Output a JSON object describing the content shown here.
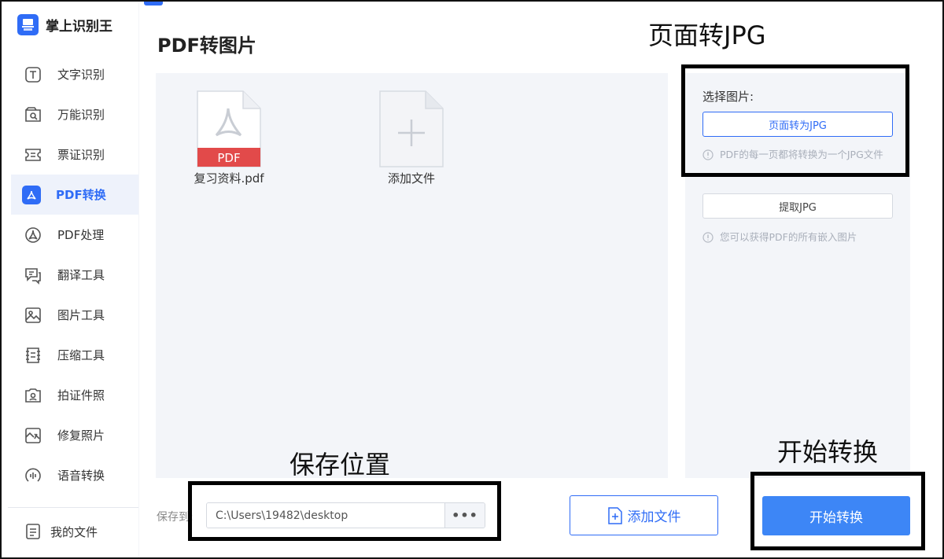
{
  "app": {
    "name": "掌上识别王",
    "brand_color": "#2f6cf6"
  },
  "sidebar": {
    "items": [
      {
        "label": "文字识别",
        "icon": "text-recognition-icon"
      },
      {
        "label": "万能识别",
        "icon": "universal-recognition-icon"
      },
      {
        "label": "票证识别",
        "icon": "ticket-recognition-icon"
      },
      {
        "label": "PDF转换",
        "icon": "pdf-convert-icon",
        "active": true
      },
      {
        "label": "PDF处理",
        "icon": "pdf-process-icon"
      },
      {
        "label": "翻译工具",
        "icon": "translate-icon"
      },
      {
        "label": "图片工具",
        "icon": "image-tools-icon"
      },
      {
        "label": "压缩工具",
        "icon": "compress-icon"
      },
      {
        "label": "拍证件照",
        "icon": "id-photo-icon"
      },
      {
        "label": "修复照片",
        "icon": "photo-repair-icon"
      },
      {
        "label": "语音转换",
        "icon": "voice-convert-icon"
      }
    ],
    "my_files": "我的文件"
  },
  "main": {
    "title": "PDF转图片",
    "files": [
      {
        "name": "复习资料.pdf",
        "badge": "PDF"
      },
      {
        "name": "添加文件"
      }
    ]
  },
  "options": {
    "title": "选择图片:",
    "primary_btn": "页面转为JPG",
    "primary_hint": "PDF的每一页都将转换为一个JPG文件",
    "secondary_btn": "提取JPG",
    "secondary_hint": "您可以获得PDF的所有嵌入图片"
  },
  "bottom": {
    "save_label": "保存到:",
    "save_path": "C:\\Users\\19482\\desktop",
    "more_btn": "•••",
    "add_file_btn": "添加文件",
    "start_btn": "开始转换"
  },
  "annotations": {
    "page_to_jpg": "页面转JPG",
    "save_location": "保存位置",
    "start_convert": "开始转换"
  }
}
